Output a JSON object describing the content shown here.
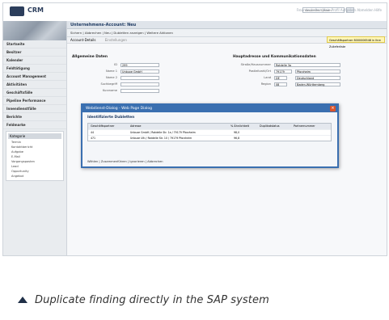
{
  "app": {
    "logo_text": "CRM",
    "top_links": "Freundschaften Mein Profil Aufgaben Abmelden Hilfe",
    "search_placeholder": "Gesamtes System"
  },
  "nav": {
    "items": [
      "Startseite",
      "Besitzer",
      "Kalender",
      "Feldtätigung",
      "Account Management",
      "Aktivitäten",
      "Geschäftsfälle",
      "Pipeline Performance",
      "Innendienstfälle",
      "Berichte",
      "Feldmarke"
    ],
    "subpanel_title": "Kategorie",
    "subitems": [
      "Termin",
      "Kontaktbericht",
      "Aufgabe",
      "E-Mail",
      "Vorgangsposten",
      "Lead",
      "Opportunity",
      "Angebot"
    ]
  },
  "main": {
    "title": "Unternehmens-Account: Neu",
    "toolbar": "Sichern | Abbrechen | Neu | Dubletten anzeigen | Weitere Aktionen",
    "hint": "Geschäftspartner 8000006546 in Ihre Zulieferliste",
    "section": "Account-Details",
    "section_right": "Einstellungen",
    "left_col_title": "Allgemeine Daten",
    "right_col_title": "Hauptadresse und Kommunikationsdaten",
    "left_fields": [
      {
        "label": "ID",
        "value": "299"
      },
      {
        "label": "Name 1",
        "value": "Unbuxe GmbH"
      },
      {
        "label": "Name 2",
        "value": ""
      },
      {
        "label": "Suchbegriff",
        "value": ""
      },
      {
        "label": "Kurzname",
        "value": ""
      }
    ],
    "right_fields": [
      {
        "label": "Straße/Hausnummer",
        "value": "Rotdelle 3a"
      },
      {
        "label": "Postleitzahl/Ort",
        "value": "79179",
        "extra": "Pforzheim"
      },
      {
        "label": "Land",
        "value": "DE",
        "extra": "Deutschland"
      },
      {
        "label": "Region",
        "value": "08",
        "extra": "Baden-Württemberg"
      }
    ]
  },
  "popup": {
    "title": "Webdienst-Dialog - Web Page Dialog",
    "close": "×",
    "heading": "Identifizierte Dubletten",
    "columns": [
      "Geschäftspartner",
      "Adresse",
      "% Ähnlichkeit",
      "Duplikatstatus",
      "Partnernummer"
    ],
    "rows": [
      {
        "id": "44",
        "address": "Unbuxe GmbH / Rotdelle Str. 1a / 79179 Pforzheim",
        "score": "98,0",
        "status": ""
      },
      {
        "id": "471",
        "address": "Unbuxe Ulti / Rotdelle Str. 10 / 79179 Pforzheim",
        "score": "96,8",
        "status": ""
      }
    ],
    "footer": "Wählen | Zusammenführen | Ignorieren | Abbrechen"
  },
  "caption": "Duplicate finding directly in the SAP system",
  "colors": {
    "accent": "#3a6fb0",
    "dialog_close": "#d9532b",
    "caption_triangle": "#1f2f47"
  }
}
